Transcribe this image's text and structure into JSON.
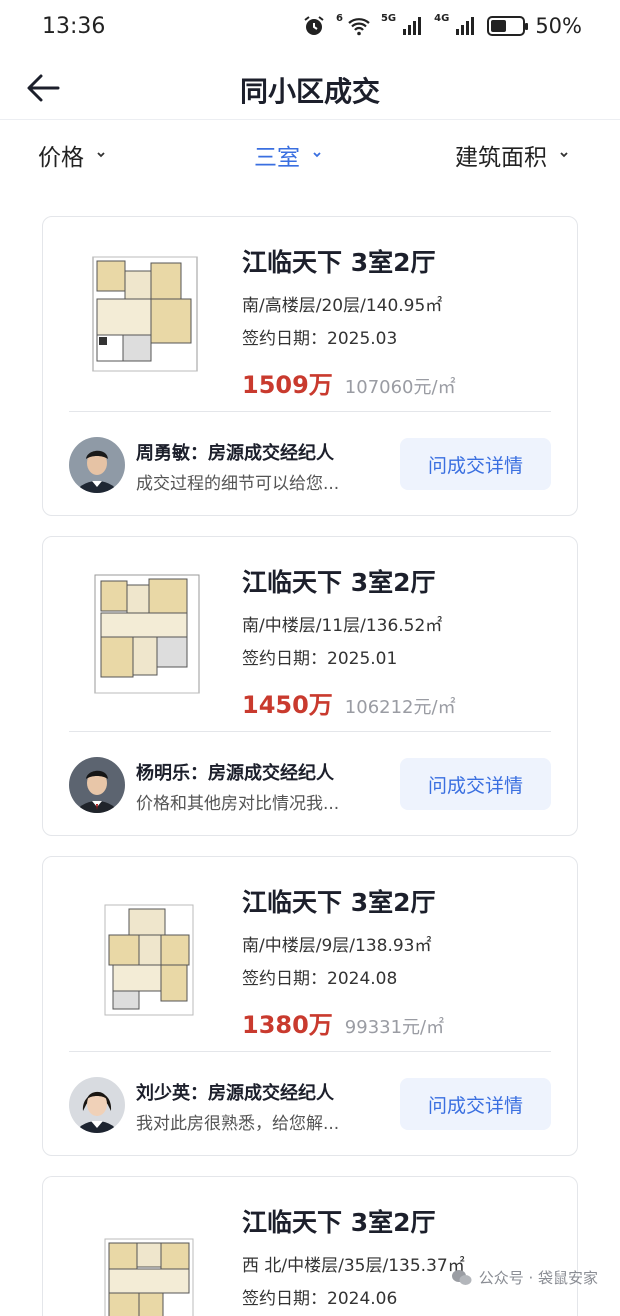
{
  "status_bar": {
    "time": "13:36",
    "network_a": "6",
    "network_b": "5G",
    "network_c": "4G",
    "battery": "50%",
    "battery_level": 0.5
  },
  "header": {
    "title": "同小区成交"
  },
  "filters": [
    {
      "label": "价格",
      "active": false
    },
    {
      "label": "三室",
      "active": true
    },
    {
      "label": "建筑面积",
      "active": false
    }
  ],
  "listings": [
    {
      "title": "江临天下 3室2厅",
      "meta": "南/高楼层/20层/140.95㎡",
      "date": "签约日期：2025.03",
      "price": "1509万",
      "unit_price": "107060元/㎡",
      "agent_name": "周勇敏：房源成交经纪人",
      "agent_msg": "成交过程的细节可以给您...",
      "button": "问成交详情"
    },
    {
      "title": "江临天下 3室2厅",
      "meta": "南/中楼层/11层/136.52㎡",
      "date": "签约日期：2025.01",
      "price": "1450万",
      "unit_price": "106212元/㎡",
      "agent_name": "杨明乐：房源成交经纪人",
      "agent_msg": "价格和其他房对比情况我...",
      "button": "问成交详情"
    },
    {
      "title": "江临天下 3室2厅",
      "meta": "南/中楼层/9层/138.93㎡",
      "date": "签约日期：2024.08",
      "price": "1380万",
      "unit_price": "99331元/㎡",
      "agent_name": "刘少英：房源成交经纪人",
      "agent_msg": "我对此房很熟悉，给您解...",
      "button": "问成交详情"
    },
    {
      "title": "江临天下 3室2厅",
      "meta": "西 北/中楼层/35层/135.37㎡",
      "date": "签约日期：2024.06"
    }
  ],
  "watermark": "公众号 · 袋鼠安家",
  "colors": {
    "accent": "#3a6fe0",
    "price": "#c93a2e",
    "button_bg": "#eef3fd"
  }
}
